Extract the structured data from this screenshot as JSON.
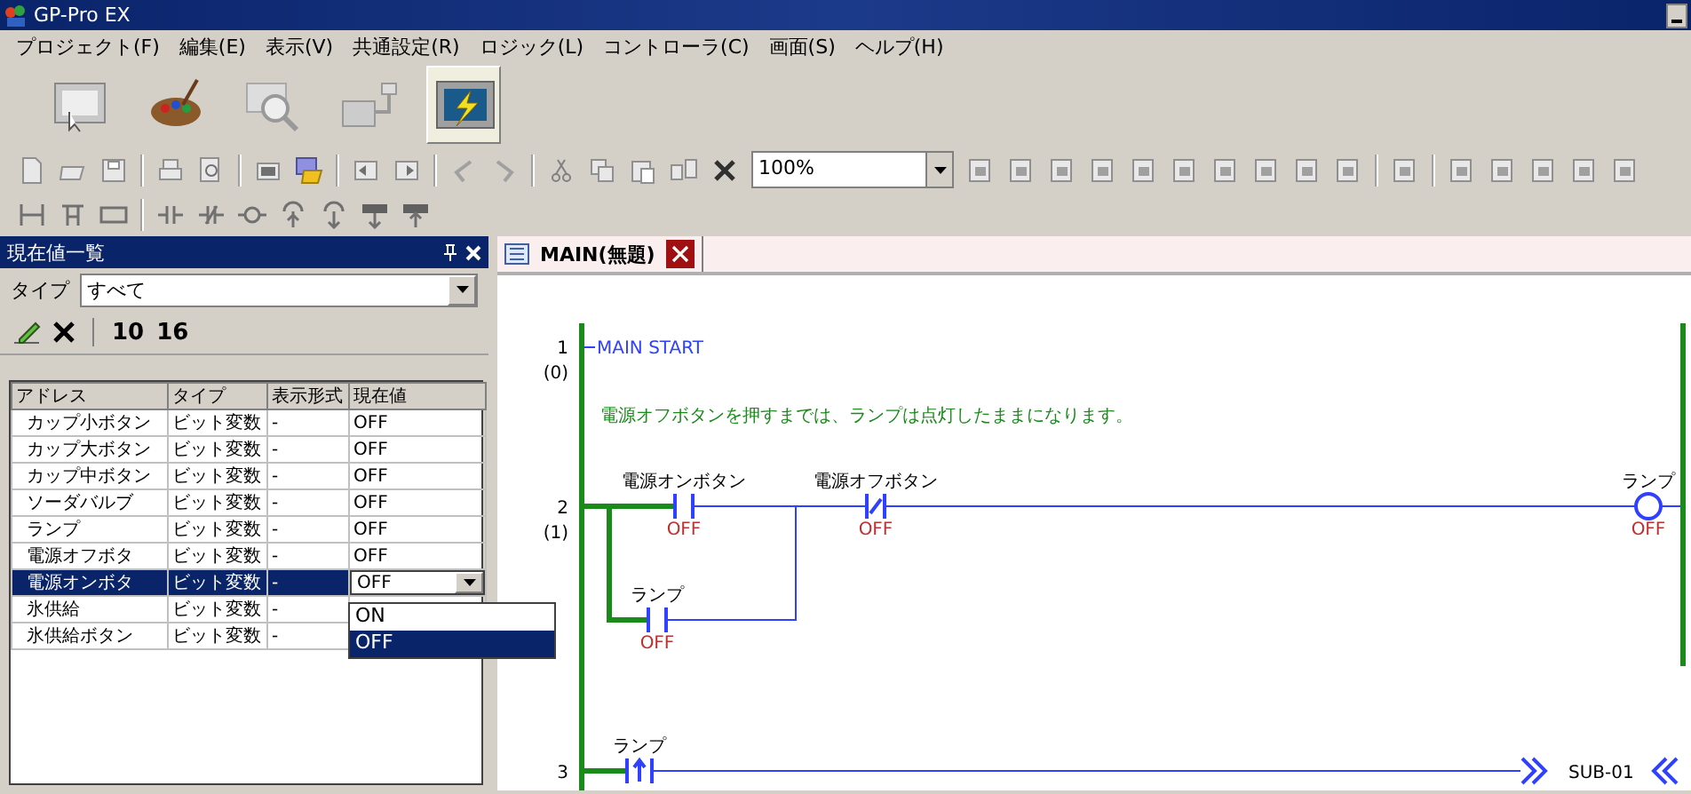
{
  "window": {
    "title": "GP-Pro EX"
  },
  "menu": [
    "プロジェクト(F)",
    "編集(E)",
    "表示(V)",
    "共通設定(R)",
    "ロジック(L)",
    "コントローラ(C)",
    "画面(S)",
    "ヘルプ(H)"
  ],
  "big_tools": [
    {
      "selected": false
    },
    {
      "selected": false
    },
    {
      "selected": false
    },
    {
      "selected": false
    },
    {
      "selected": true
    }
  ],
  "zoom": {
    "value": "100%"
  },
  "values_panel": {
    "title": "現在値一覧",
    "type_label": "タイプ",
    "type_value": "すべて",
    "radix_buttons": [
      "10",
      "16"
    ],
    "columns": [
      "アドレス",
      "タイプ",
      "表示形式",
      "現在値"
    ],
    "rows": [
      {
        "address": "カップ小ボタン",
        "type": "ビット変数",
        "format": "-",
        "value": "OFF",
        "selected": false
      },
      {
        "address": "カップ大ボタン",
        "type": "ビット変数",
        "format": "-",
        "value": "OFF",
        "selected": false
      },
      {
        "address": "カップ中ボタン",
        "type": "ビット変数",
        "format": "-",
        "value": "OFF",
        "selected": false
      },
      {
        "address": "ソーダバルブ",
        "type": "ビット変数",
        "format": "-",
        "value": "OFF",
        "selected": false
      },
      {
        "address": "ランプ",
        "type": "ビット変数",
        "format": "-",
        "value": "OFF",
        "selected": false
      },
      {
        "address": "電源オフボタ",
        "type": "ビット変数",
        "format": "-",
        "value": "OFF",
        "selected": false
      },
      {
        "address": "電源オンボタ",
        "type": "ビット変数",
        "format": "-",
        "value": "OFF",
        "selected": true
      },
      {
        "address": "氷供給",
        "type": "ビット変数",
        "format": "-",
        "value": "",
        "selected": false
      },
      {
        "address": "氷供給ボタン",
        "type": "ビット変数",
        "format": "-",
        "value": "",
        "selected": false
      }
    ],
    "dropdown": [
      {
        "label": "ON",
        "selected": false
      },
      {
        "label": "OFF",
        "selected": true
      }
    ]
  },
  "editor": {
    "tab": "MAIN(無題)",
    "rungs": [
      {
        "number": "1",
        "step": "(0)",
        "label": "MAIN START",
        "comment": "電源オフボタンを押すまでは、ランプは点灯したままになります。"
      },
      {
        "number": "2",
        "step": "(1)",
        "elements": [
          {
            "kind": "no_contact",
            "label": "電源オンボタン",
            "state": "OFF"
          },
          {
            "kind": "nc_contact",
            "label": "電源オフボタン",
            "state": "OFF"
          },
          {
            "kind": "coil",
            "label": "ランプ",
            "state": "OFF"
          },
          {
            "kind": "no_contact",
            "label": "ランプ",
            "state": "OFF"
          }
        ]
      },
      {
        "number": "3",
        "elements": [
          {
            "kind": "rising_contact",
            "label": "ランプ"
          },
          {
            "kind": "jump",
            "label": "SUB-01"
          }
        ]
      }
    ]
  }
}
